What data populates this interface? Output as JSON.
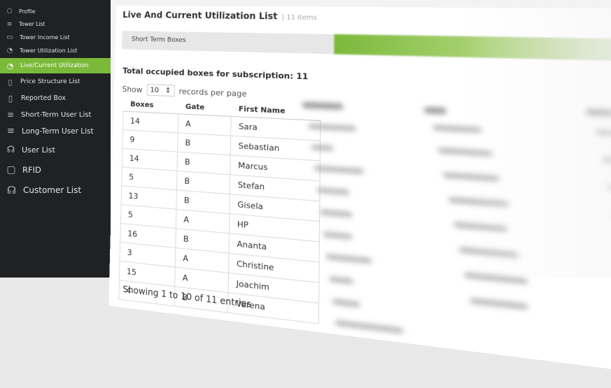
{
  "sidebar": {
    "items": [
      {
        "label": "Profile",
        "icon": "user-icon",
        "glyph": "○"
      },
      {
        "label": "Tower List",
        "icon": "list-icon",
        "glyph": "≡"
      },
      {
        "label": "Tower Income List",
        "icon": "document-icon",
        "glyph": "▭"
      },
      {
        "label": "Tower Utilization List",
        "icon": "pie-icon",
        "glyph": "◔"
      },
      {
        "label": "Live/Current Utilization",
        "icon": "pie-icon",
        "glyph": "◔",
        "active": true
      },
      {
        "label": "Price Structure List",
        "icon": "document-icon",
        "glyph": "▯"
      },
      {
        "label": "Reported Box",
        "icon": "document-icon",
        "glyph": "▯"
      },
      {
        "label": "Short-Term User List",
        "icon": "list-icon",
        "glyph": "≡"
      },
      {
        "label": "Long-Term User List",
        "icon": "list-icon",
        "glyph": "≡"
      },
      {
        "label": "User List",
        "icon": "users-icon",
        "glyph": "☊"
      },
      {
        "label": "RFID",
        "icon": "card-icon",
        "glyph": "▢"
      },
      {
        "label": "Customer List",
        "icon": "users-icon",
        "glyph": "☊"
      }
    ]
  },
  "page": {
    "title": "Live And Current Utilization List",
    "subtitle": "| 11 items",
    "tab_label": "Short Term Boxes",
    "occupied_text": "Total occupied boxes for subscription: 11",
    "show_label": "Show",
    "page_size": "10",
    "records_label": "records per page",
    "info": "Showing 1 to 10 of 11 entries"
  },
  "table": {
    "headers": [
      "Boxes",
      "Gate",
      "First Name"
    ],
    "rows": [
      [
        "14",
        "A",
        "Sara"
      ],
      [
        "9",
        "B",
        "Sebastian"
      ],
      [
        "14",
        "B",
        "Marcus"
      ],
      [
        "5",
        "B",
        "Stefan"
      ],
      [
        "13",
        "B",
        "Gisela"
      ],
      [
        "5",
        "A",
        "HP"
      ],
      [
        "16",
        "B",
        "Ananta"
      ],
      [
        "3",
        "A",
        "Christine"
      ],
      [
        "15",
        "A",
        "Joachim"
      ],
      [
        "4",
        "B",
        "Verena"
      ]
    ]
  },
  "colors": {
    "accent": "#7ab939",
    "sidebar": "#1f2123"
  }
}
